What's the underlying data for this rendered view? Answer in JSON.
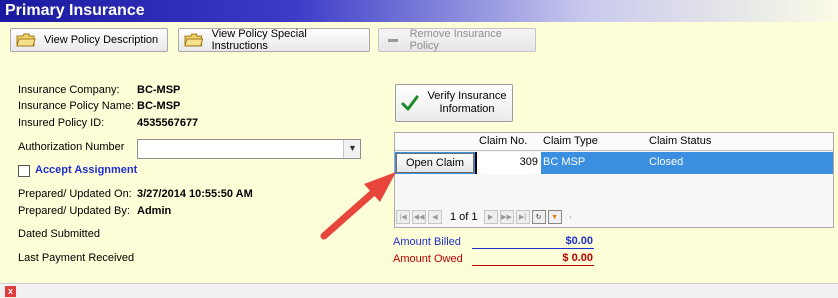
{
  "header": {
    "title": "Primary Insurance"
  },
  "toolbar": {
    "view_policy_description": "View Policy Description",
    "view_policy_special_instructions": "View Policy Special Instructions",
    "remove_insurance_policy": "Remove Insurance Policy"
  },
  "policy": {
    "company_label": "Insurance Company:",
    "company_value": "BC-MSP",
    "name_label": "Insurance Policy Name:",
    "name_value": "BC-MSP",
    "id_label": "Insured Policy ID:",
    "id_value": "4535567677",
    "authorization_label": "Authorization Number",
    "authorization_value": "",
    "accept_assignment": "Accept Assignment",
    "prepared_on_label": "Prepared/ Updated  On:",
    "prepared_on_value": "3/27/2014 10:55:50 AM",
    "prepared_by_label": "Prepared/ Updated  By:",
    "prepared_by_value": "Admin",
    "dated_submitted_label": "Dated Submitted",
    "last_payment_label": "Last Payment Received"
  },
  "verify_button": {
    "line1": "Verify Insurance",
    "line2": "Information"
  },
  "claims": {
    "columns": [
      "Claim No.",
      "Claim Type",
      "Claim Status"
    ],
    "rows": [
      {
        "action": "Open Claim",
        "claim_no": "309",
        "claim_type": "BC MSP",
        "claim_status": "Closed"
      }
    ],
    "pager": "1 of 1"
  },
  "amounts": {
    "billed_label": "Amount Billed",
    "billed_value": "$0.00",
    "owed_label": "Amount Owed",
    "owed_value": "$ 0.00"
  },
  "colors": {
    "accent_blue": "#1f2fd0",
    "selection_blue": "#3a8fe0",
    "owed_red": "#c00000",
    "arrow_red": "#e8453c"
  },
  "icons": [
    "folder-icon",
    "minus-icon",
    "checkmark-icon",
    "dropdown-arrow-icon",
    "filter-icon",
    "refresh-icon",
    "close-icon"
  ]
}
